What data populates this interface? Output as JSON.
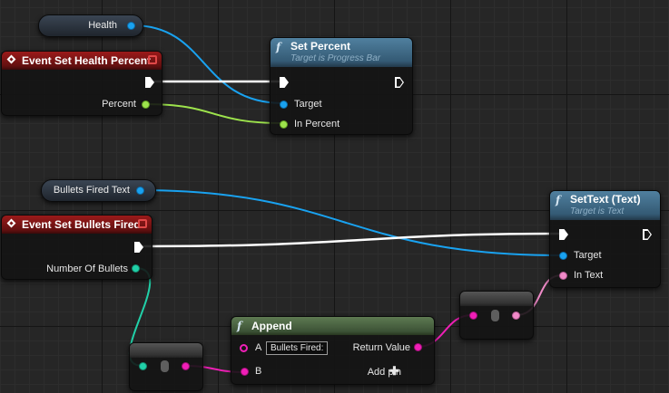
{
  "variables": {
    "health": {
      "label": "Health"
    },
    "bullets_fired_text": {
      "label": "Bullets Fired Text"
    }
  },
  "events": {
    "health_percent": {
      "title": "Event Set Health Percent",
      "out_pin": "Percent"
    },
    "bullets_fired": {
      "title": "Event Set Bullets Fired",
      "out_pin": "Number Of Bullets"
    }
  },
  "functions": {
    "set_percent": {
      "title": "Set Percent",
      "subtitle": "Target is Progress Bar",
      "pins": {
        "target": "Target",
        "in_percent": "In Percent"
      }
    },
    "set_text": {
      "title": "SetText (Text)",
      "subtitle": "Target is Text",
      "pins": {
        "target": "Target",
        "in_text": "In Text"
      }
    },
    "append": {
      "title": "Append",
      "pin_a": "A",
      "pin_a_value": "Bullets Fired:",
      "pin_b": "B",
      "return_value": "Return Value",
      "add_pin": "Add pin"
    }
  },
  "icons": {
    "function": "f-icon",
    "event": "diamond-icon",
    "stop": "stop-square-icon",
    "add": "plus-icon"
  },
  "colors": {
    "object_pin": "#19a2f0",
    "float_pin": "#9de34c",
    "string_pin": "#f01fb7",
    "text_pin": "#f08ac8",
    "int_pin": "#21d0a8",
    "exec_wire": "#ffffff",
    "event_header": "#9b1a1a",
    "function_header": "#50809f",
    "pure_function_header": "#5e7a52"
  }
}
